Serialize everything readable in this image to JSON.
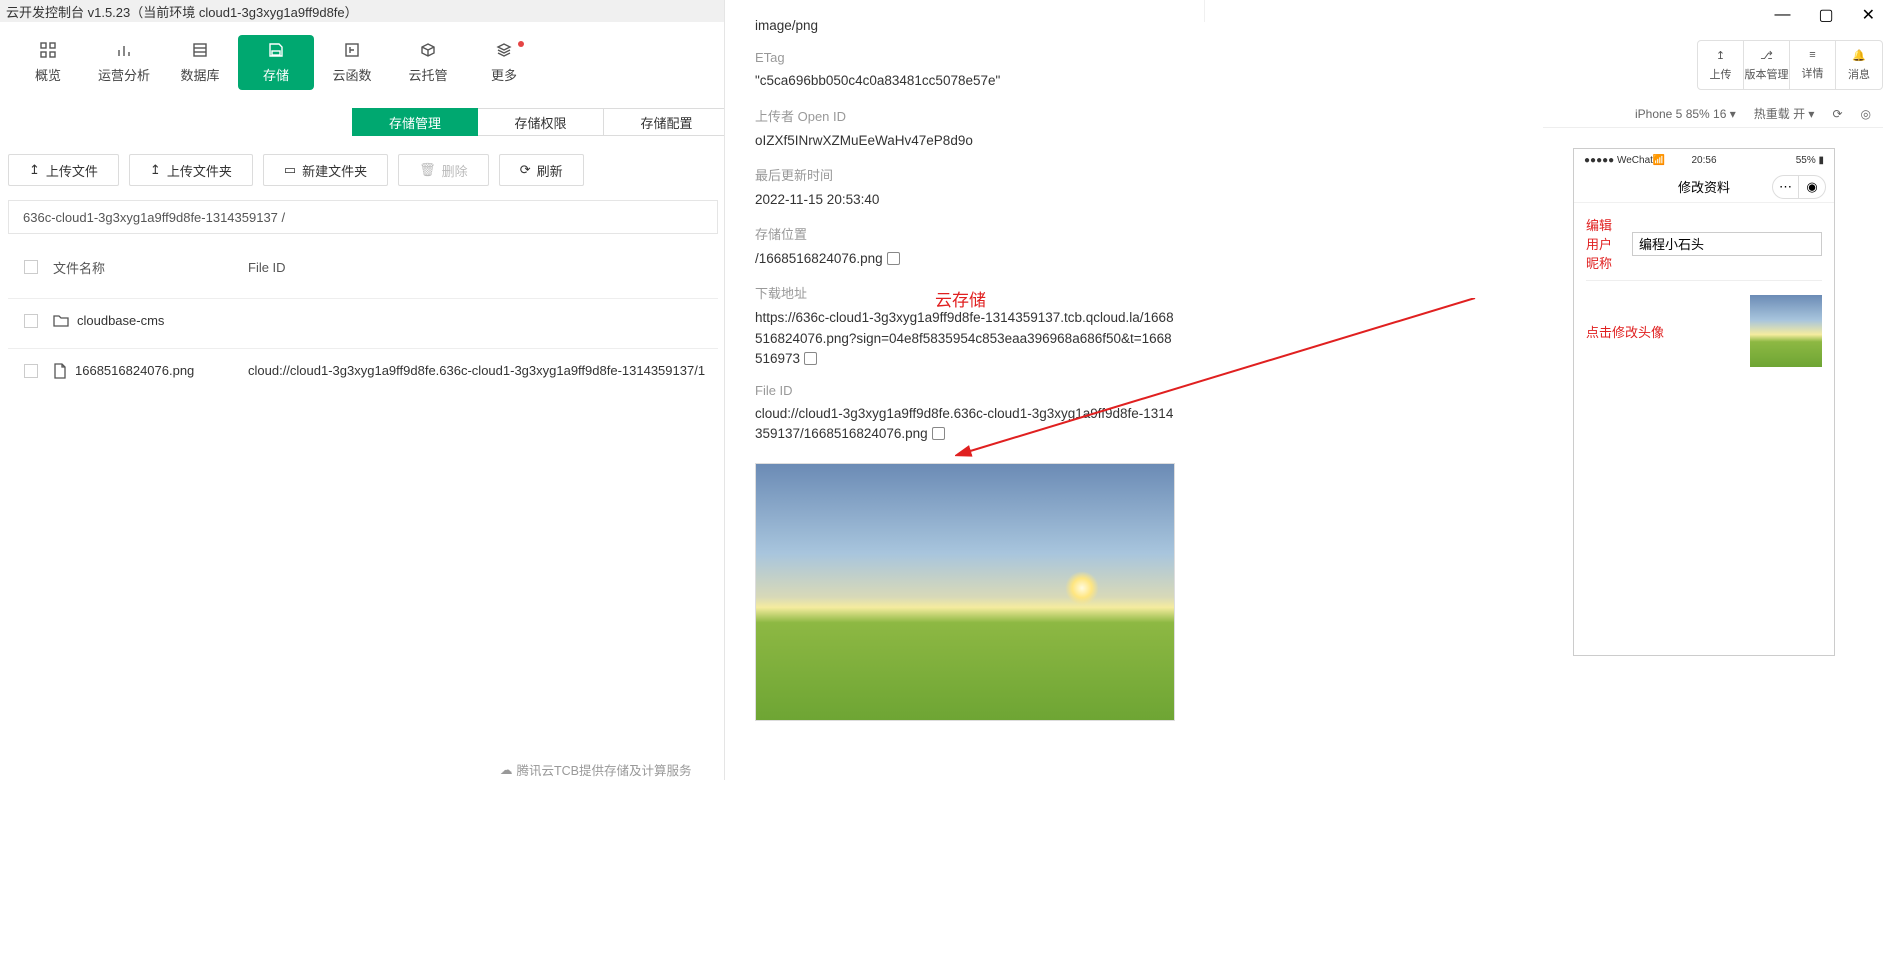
{
  "titlebar": {
    "title": "云开发控制台 v1.5.23（当前环境 cloud1-3g3xyg1a9ff9d8fe）"
  },
  "nav": {
    "items": [
      {
        "label": "概览"
      },
      {
        "label": "运营分析"
      },
      {
        "label": "数据库"
      },
      {
        "label": "存储"
      },
      {
        "label": "云函数"
      },
      {
        "label": "云托管"
      },
      {
        "label": "更多"
      }
    ]
  },
  "tabs": {
    "manage": "存储管理",
    "permission": "存储权限",
    "config": "存储配置"
  },
  "actions": {
    "upload_file": "上传文件",
    "upload_folder": "上传文件夹",
    "new_folder": "新建文件夹",
    "delete": "删除",
    "refresh": "刷新"
  },
  "breadcrumb": "636c-cloud1-3g3xyg1a9ff9d8fe-1314359137 /",
  "table": {
    "col_name": "文件名称",
    "col_fileid": "File ID",
    "rows": [
      {
        "name": "cloudbase-cms",
        "type": "folder",
        "fileid": ""
      },
      {
        "name": "1668516824076.png",
        "type": "file",
        "fileid": "cloud://cloud1-3g3xyg1a9ff9d8fe.636c-cloud1-3g3xyg1a9ff9d8fe-1314359137/1"
      }
    ]
  },
  "detail": {
    "mime": "image/png",
    "etag_label": "ETag",
    "etag": "\"c5ca696bb050c4c0a83481cc5078e57e\"",
    "uploader_label": "上传者 Open ID",
    "uploader": "oIZXf5INrwXZMuEeWaHv47eP8d9o",
    "updated_label": "最后更新时间",
    "updated": "2022-11-15 20:53:40",
    "location_label": "存储位置",
    "location": "/1668516824076.png",
    "url_label": "下载地址",
    "url": "https://636c-cloud1-3g3xyg1a9ff9d8fe-1314359137.tcb.qcloud.la/1668516824076.png?sign=04e8f5835954c853eaa396968a686f50&t=1668516973",
    "fileid_label": "File ID",
    "fileid": "cloud://cloud1-3g3xyg1a9ff9d8fe.636c-cloud1-3g3xyg1a9ff9d8fe-1314359137/1668516824076.png"
  },
  "annotation": {
    "cloud_storage": "云存储"
  },
  "footer": "腾讯云TCB提供存储及计算服务",
  "right_toolbar": {
    "upload": "上传",
    "version": "版本管理",
    "detail": "详情",
    "message": "消息"
  },
  "devbar": {
    "device": "iPhone 5 85% 16",
    "reload": "热重载 开"
  },
  "phone": {
    "carrier": "●●●●● WeChat",
    "time": "20:56",
    "battery": "55%",
    "header": "修改资料",
    "nickname_label": "编辑用户昵称",
    "nickname_value": "编程小石头",
    "avatar_label": "点击修改头像"
  }
}
